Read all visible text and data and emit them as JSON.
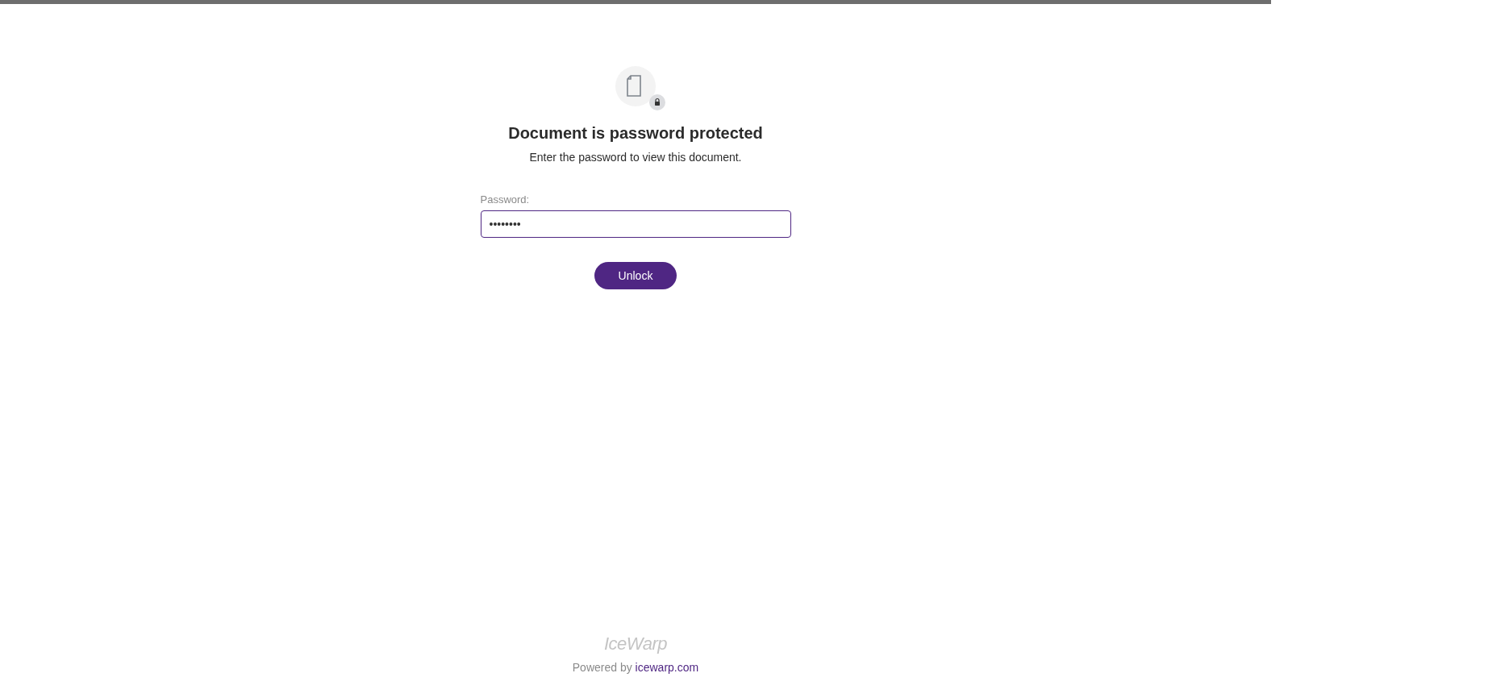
{
  "title": "Document is password protected",
  "subtitle": "Enter the password to view this document.",
  "password_field": {
    "label": "Password:",
    "value": "••••••••"
  },
  "unlock_button": "Unlock",
  "footer": {
    "logo": "IceWarp",
    "powered_by": "Powered by",
    "link": "icewarp.com"
  }
}
